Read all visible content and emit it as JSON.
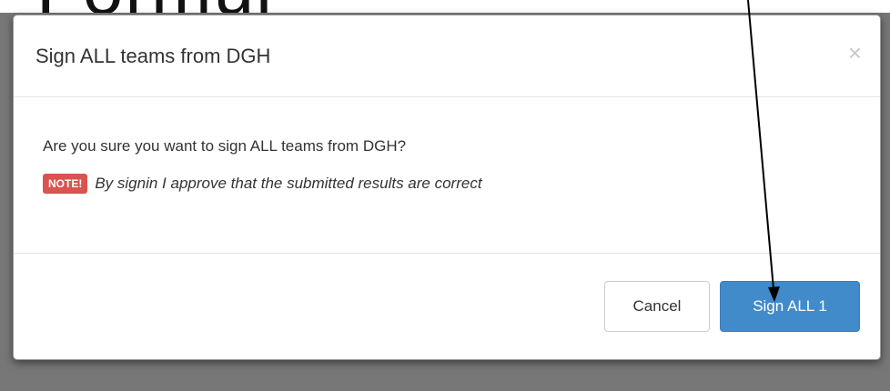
{
  "backdrop": {
    "heading": "Formul"
  },
  "modal": {
    "title": "Sign ALL teams from DGH",
    "close_glyph": "×",
    "question": "Are you sure you want to sign ALL teams from DGH?",
    "note_badge": "NOTE!",
    "note_text": "By signin I approve that the submitted results are correct",
    "cancel_label": "Cancel",
    "confirm_label": "Sign ALL 1"
  },
  "colors": {
    "primary": "#428bca",
    "danger": "#d9534f",
    "backdrop": "#777777"
  }
}
